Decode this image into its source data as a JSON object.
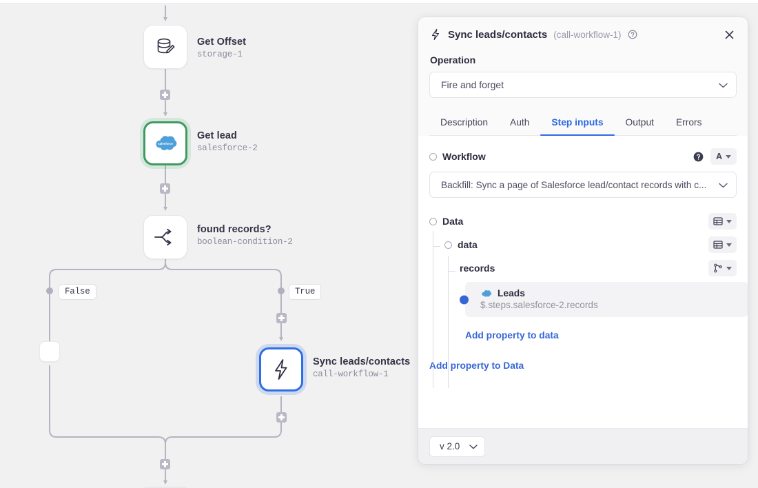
{
  "canvas": {
    "nodes": [
      {
        "id": "storage-1",
        "title": "Get Offset",
        "subtitle": "storage-1",
        "icon": "database-pencil-icon"
      },
      {
        "id": "salesforce-2",
        "title": "Get lead",
        "subtitle": "salesforce-2",
        "icon": "salesforce-cloud-icon"
      },
      {
        "id": "boolean-condition-2",
        "title": "found records?",
        "subtitle": "boolean-condition-2",
        "icon": "branch-split-icon"
      },
      {
        "id": "call-workflow-1",
        "title": "Sync leads/contacts",
        "subtitle": "call-workflow-1",
        "icon": "lightning-bolt-icon"
      }
    ],
    "branch_labels": {
      "false": "False",
      "true": "True"
    }
  },
  "panel": {
    "title": "Sync leads/contacts",
    "step_id": "(call-workflow-1)",
    "operation_label": "Operation",
    "operation_value": "Fire and forget",
    "tabs": [
      {
        "label": "Description",
        "active": false
      },
      {
        "label": "Auth",
        "active": false
      },
      {
        "label": "Step inputs",
        "active": true
      },
      {
        "label": "Output",
        "active": false
      },
      {
        "label": "Errors",
        "active": false
      }
    ],
    "workflow": {
      "label": "Workflow",
      "type_token": "A",
      "value": "Backfill: Sync a page of Salesforce lead/contact records with c..."
    },
    "data": {
      "label": "Data",
      "type_token": "table",
      "children": [
        {
          "label": "data",
          "type_token": "table",
          "depth": 1,
          "has_radio": true
        },
        {
          "label": "records",
          "type_token": "branch",
          "depth": 2,
          "has_radio": false
        }
      ],
      "leads_card": {
        "title": "Leads",
        "path": "$.steps.salesforce-2.records",
        "icon": "salesforce-cloud-icon"
      },
      "add_property_to_data": "Add property to data",
      "add_property_to_Data": "Add property to Data"
    },
    "footer": {
      "version": "v 2.0"
    }
  },
  "colors": {
    "accent_blue": "#2d6ae0",
    "link_blue": "#3667d6",
    "selected_green": "#3f9a5e",
    "selected_blue": "#2f6fe4",
    "dot_blue": "#3765d6",
    "edge_gray": "#b4b4c2",
    "canvas_bg": "#f1f1f2"
  }
}
